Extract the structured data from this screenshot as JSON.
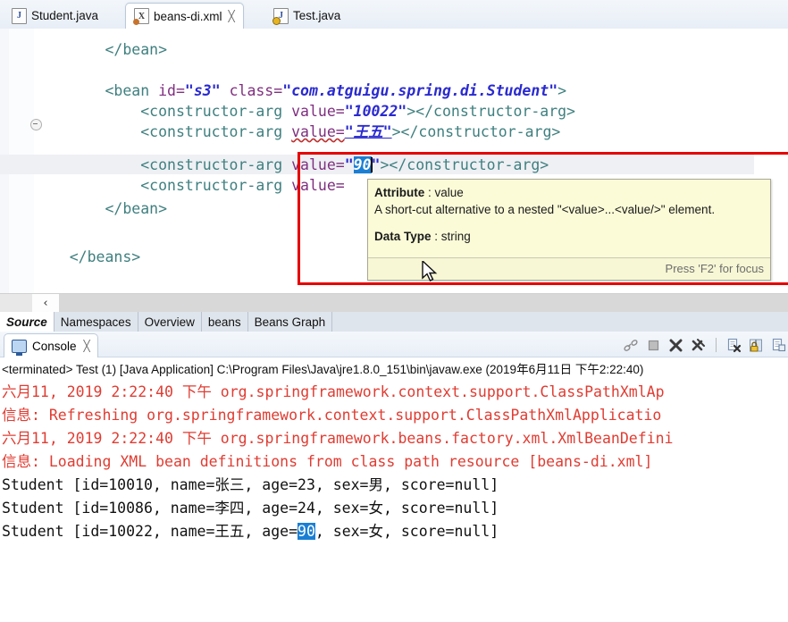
{
  "window": {
    "app": "Eclipse IDE",
    "editor_tabs": [
      {
        "label": "Student.java",
        "icon": "java-file-icon",
        "active": false,
        "closable": false
      },
      {
        "label": "beans-di.xml",
        "icon": "xml-file-icon",
        "active": true,
        "closable": true,
        "close_glyph": "╳"
      },
      {
        "label": "Test.java",
        "icon": "java-file-lock-icon",
        "active": false,
        "closable": false
      }
    ]
  },
  "editor": {
    "scroll_left_glyph": "‹",
    "lines": [
      {
        "indent": 8,
        "parts": [
          {
            "t": "</bean>",
            "c": "tag"
          }
        ]
      },
      {
        "indent": 0,
        "parts": []
      },
      {
        "indent": 8,
        "parts": [
          {
            "t": "<bean ",
            "c": "tag"
          },
          {
            "t": "id=",
            "c": "attr"
          },
          {
            "t": "\"s3\"",
            "c": "val"
          },
          {
            "t": " class=",
            "c": "attr"
          },
          {
            "t": "\"com.atguigu.spring.di.Student\"",
            "c": "val"
          },
          {
            "t": ">",
            "c": "tag"
          }
        ]
      },
      {
        "indent": 12,
        "parts": [
          {
            "t": "<constructor-arg ",
            "c": "tag"
          },
          {
            "t": "value=",
            "c": "attr"
          },
          {
            "t": "\"10022\"",
            "c": "val"
          },
          {
            "t": "></constructor-arg>",
            "c": "tag"
          }
        ]
      },
      {
        "indent": 12,
        "parts": [
          {
            "t": "<constructor-arg ",
            "c": "tag"
          },
          {
            "t": "value=",
            "c": "attr-u"
          },
          {
            "t": "\"王五\"",
            "c": "val-u"
          },
          {
            "t": "></constructor-arg>",
            "c": "tag"
          }
        ]
      },
      {
        "indent": 12,
        "current": true,
        "parts": [
          {
            "t": "<constructor-arg ",
            "c": "tag"
          },
          {
            "t": "value=",
            "c": "attr"
          },
          {
            "t": "\"",
            "c": "val"
          },
          {
            "t": "90",
            "c": "selected"
          },
          {
            "t": "\"",
            "c": "val"
          },
          {
            "t": "></constructor-arg>",
            "c": "tag"
          }
        ]
      },
      {
        "indent": 12,
        "parts": [
          {
            "t": "<constructor-arg ",
            "c": "tag"
          },
          {
            "t": "value=",
            "c": "attr"
          }
        ]
      },
      {
        "indent": 8,
        "parts": [
          {
            "t": "</bean>",
            "c": "tag"
          }
        ]
      },
      {
        "indent": 0,
        "parts": []
      },
      {
        "indent": 4,
        "parts": [
          {
            "t": "</beans>",
            "c": "tag"
          }
        ]
      }
    ]
  },
  "tooltip": {
    "attribute_label": "Attribute",
    "attribute_value": "value",
    "description": "A short-cut alternative to a nested \"<value>...<value/>\" element.",
    "datatype_label": "Data Type",
    "datatype_value": "string",
    "footer": "Press 'F2' for focus"
  },
  "bottom_tabs": {
    "items": [
      {
        "label": "Source",
        "selected": true
      },
      {
        "label": "Namespaces",
        "selected": false
      },
      {
        "label": "Overview",
        "selected": false
      },
      {
        "label": "beans",
        "selected": false
      },
      {
        "label": "Beans Graph",
        "selected": false
      }
    ]
  },
  "console": {
    "tab_label": "Console",
    "tab_close_glyph": "╳",
    "toolbar_icons": [
      "link-icon",
      "terminate-icon",
      "remove-launch-icon",
      "remove-all-launches-icon",
      "clear-console-icon",
      "scroll-lock-icon",
      "pin-console-icon"
    ],
    "process_line": "<terminated> Test (1) [Java Application] C:\\Program Files\\Java\\jre1.8.0_151\\bin\\javaw.exe (2019年6月11日 下午2:22:40)",
    "output": [
      {
        "color": "red",
        "text": "六月11, 2019 2:22:40 下午 org.springframework.context.support.ClassPathXmlAp"
      },
      {
        "color": "red",
        "text": "信息: Refreshing org.springframework.context.support.ClassPathXmlApplicatio"
      },
      {
        "color": "red",
        "text": "六月11, 2019 2:22:40 下午 org.springframework.beans.factory.xml.XmlBeanDefini"
      },
      {
        "color": "red",
        "text": "信息: Loading XML bean definitions from class path resource [beans-di.xml]"
      },
      {
        "color": "black",
        "text": "Student [id=10010, name=张三, age=23, sex=男, score=null]"
      },
      {
        "color": "black",
        "text": "Student [id=10086, name=李四, age=24, sex=女, score=null]"
      },
      {
        "color": "black",
        "segments": [
          {
            "t": "Student [id=10022, name=王五, age=",
            "sel": false
          },
          {
            "t": "90",
            "sel": true
          },
          {
            "t": ", sex=女, score=null]",
            "sel": false
          }
        ]
      }
    ]
  },
  "colors": {
    "annotation_red": "#e60000",
    "selection_blue": "#1a7fd4",
    "log_red": "#e03c32",
    "xml_tag": "#3f7f7f",
    "xml_attr": "#7f2f7f",
    "xml_value": "#2a2ad0",
    "tooltip_bg": "#fbfbd8"
  }
}
